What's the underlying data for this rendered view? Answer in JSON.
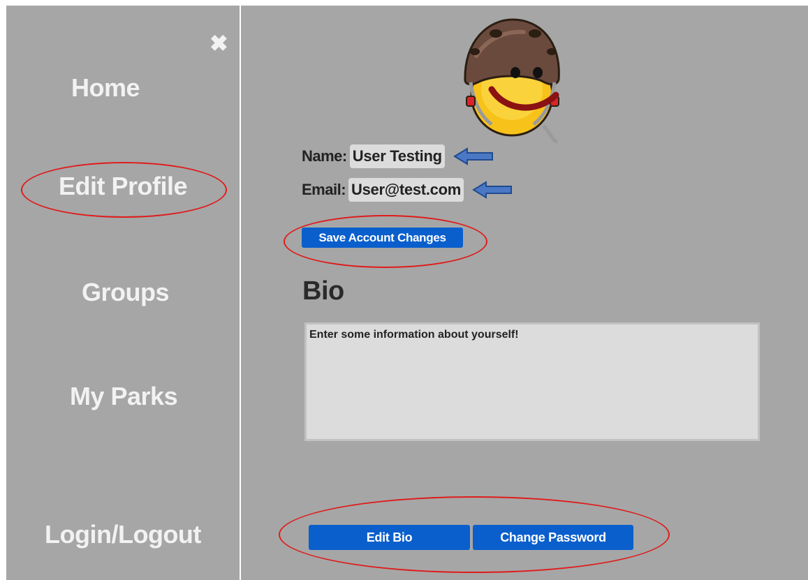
{
  "sidebar": {
    "close_glyph": "✖",
    "items": [
      {
        "label": "Home"
      },
      {
        "label": "Edit Profile"
      },
      {
        "label": "Groups"
      },
      {
        "label": "My Parks"
      },
      {
        "label": "Login/Logout"
      }
    ]
  },
  "profile": {
    "avatar_icon": "helmet-smiley-icon",
    "name_label": "Name:",
    "name_value": "User Testing",
    "email_label": "Email:",
    "email_value": "User@test.com",
    "save_button": "Save Account Changes"
  },
  "bio": {
    "heading": "Bio",
    "placeholder": "Enter some information about yourself!"
  },
  "actions": {
    "edit_bio": "Edit Bio",
    "change_password": "Change Password"
  },
  "colors": {
    "panel_bg": "#a6a6a6",
    "button_blue": "#0a5fcc",
    "annotation_red": "#e01b1b",
    "arrow_blue": "#4a78c4"
  }
}
